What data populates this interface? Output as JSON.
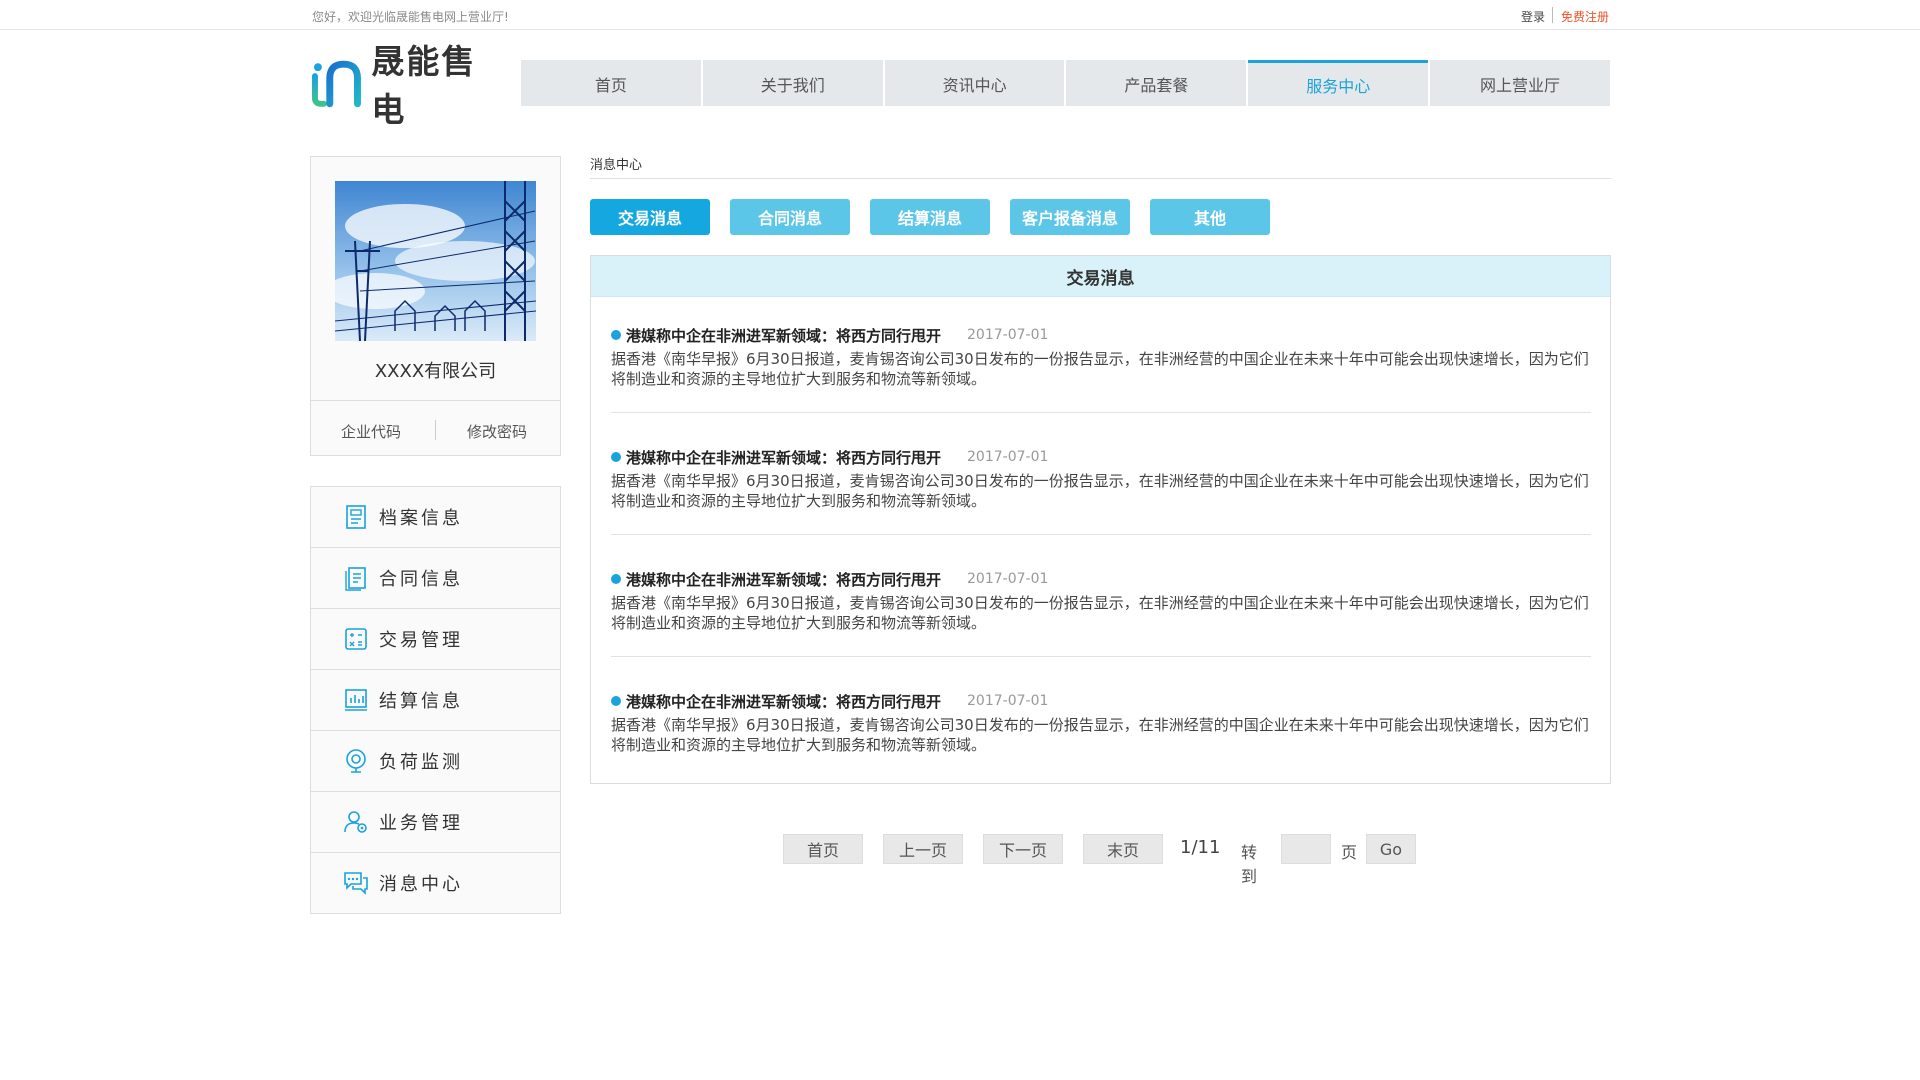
{
  "topbar": {
    "welcome": "您好，欢迎光临晟能售电网上营业厅!",
    "login": "登录",
    "register": "免费注册"
  },
  "brand": {
    "name": "晟能售电"
  },
  "nav": {
    "items": [
      "首页",
      "关于我们",
      "资讯中心",
      "产品套餐",
      "服务中心",
      "网上营业厅"
    ],
    "active": "服务中心"
  },
  "profile": {
    "company": "XXXX有限公司",
    "code_label": "企业代码",
    "password_label": "修改密码"
  },
  "menu": {
    "items": [
      {
        "label": "档案信息",
        "icon": "file-icon"
      },
      {
        "label": "合同信息",
        "icon": "contract-icon"
      },
      {
        "label": "交易管理",
        "icon": "calculator-icon"
      },
      {
        "label": "结算信息",
        "icon": "bar-chart-icon"
      },
      {
        "label": "负荷监测",
        "icon": "monitor-icon"
      },
      {
        "label": "业务管理",
        "icon": "user-gear-icon"
      },
      {
        "label": "消息中心",
        "icon": "chat-icon"
      }
    ]
  },
  "breadcrumb": "消息中心",
  "tabs": {
    "items": [
      "交易消息",
      "合同消息",
      "结算消息",
      "客户报备消息",
      "其他"
    ],
    "active": "交易消息"
  },
  "panel": {
    "title": "交易消息",
    "news": [
      {
        "title": "港媒称中企在非洲进军新领域：将西方同行甩开",
        "date": "2017-07-01",
        "body": "据香港《南华早报》6月30日报道，麦肯锡咨询公司30日发布的一份报告显示，在非洲经营的中国企业在未来十年中可能会出现快速增长，因为它们将制造业和资源的主导地位扩大到服务和物流等新领域。"
      },
      {
        "title": "港媒称中企在非洲进军新领域：将西方同行甩开",
        "date": "2017-07-01",
        "body": "据香港《南华早报》6月30日报道，麦肯锡咨询公司30日发布的一份报告显示，在非洲经营的中国企业在未来十年中可能会出现快速增长，因为它们将制造业和资源的主导地位扩大到服务和物流等新领域。"
      },
      {
        "title": "港媒称中企在非洲进军新领域：将西方同行甩开",
        "date": "2017-07-01",
        "body": "据香港《南华早报》6月30日报道，麦肯锡咨询公司30日发布的一份报告显示，在非洲经营的中国企业在未来十年中可能会出现快速增长，因为它们将制造业和资源的主导地位扩大到服务和物流等新领域。"
      },
      {
        "title": "港媒称中企在非洲进军新领域：将西方同行甩开",
        "date": "2017-07-01",
        "body": "据香港《南华早报》6月30日报道，麦肯锡咨询公司30日发布的一份报告显示，在非洲经营的中国企业在未来十年中可能会出现快速增长，因为它们将制造业和资源的主导地位扩大到服务和物流等新领域。"
      }
    ]
  },
  "pager": {
    "first": "首页",
    "prev": "上一页",
    "next": "下一页",
    "last": "末页",
    "current": "1/11",
    "goto_label": "转到",
    "goto_value": "",
    "page_unit": "页",
    "go": "Go"
  },
  "colors": {
    "accent": "#1aa3dc",
    "tab": "#5cc6e8",
    "register": "#e8542a"
  }
}
